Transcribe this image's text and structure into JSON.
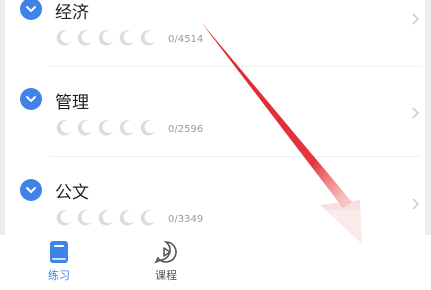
{
  "categories": [
    {
      "title": "经济",
      "count": "0/4514"
    },
    {
      "title": "管理",
      "count": "0/2596"
    },
    {
      "title": "公文",
      "count": "0/3349"
    }
  ],
  "tabs": [
    {
      "label": "练习",
      "icon": "book-icon"
    },
    {
      "label": "课程",
      "icon": "play-bubble-icon"
    }
  ],
  "colors": {
    "accent": "#3f82e8",
    "annotation_arrow": "#e0202a"
  }
}
